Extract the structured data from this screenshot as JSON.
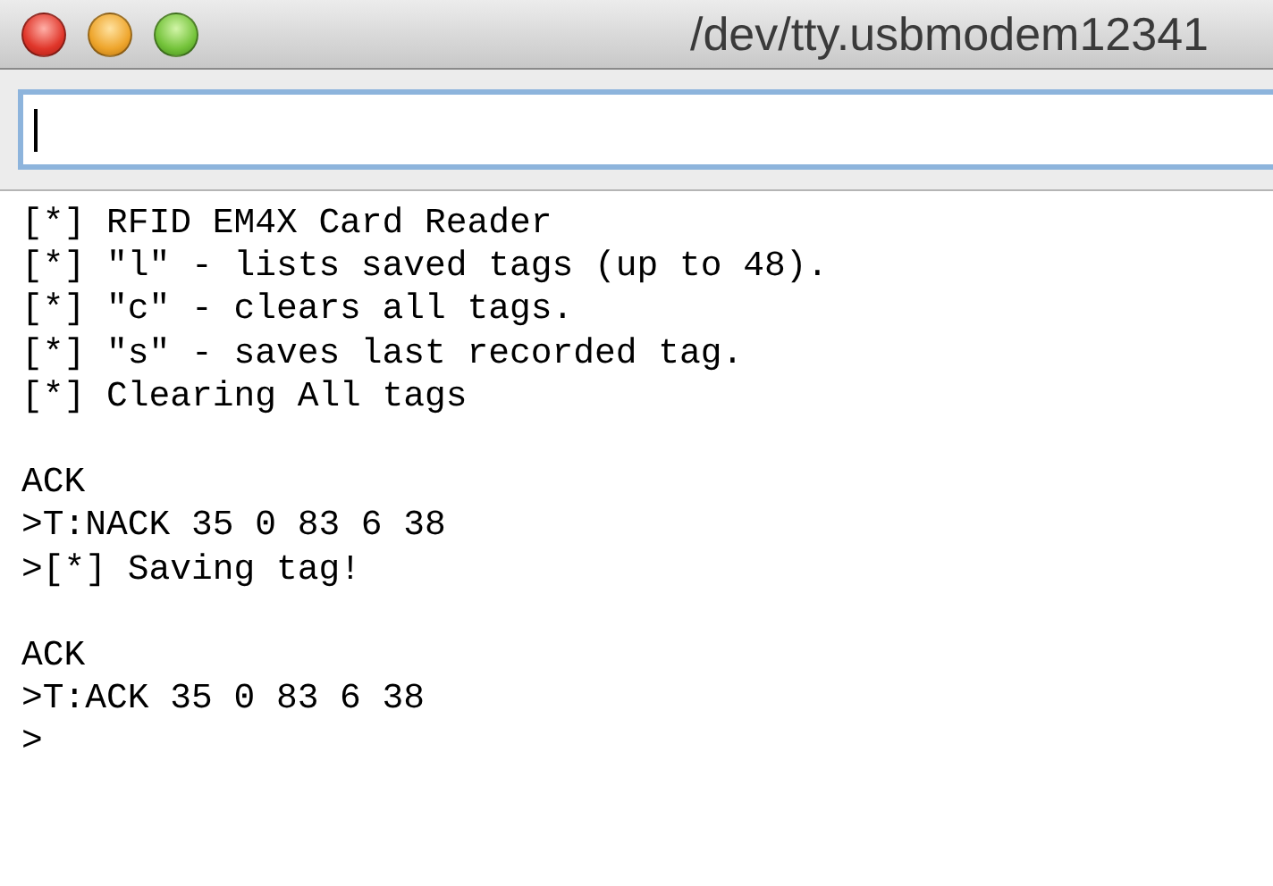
{
  "window": {
    "title": "/dev/tty.usbmodem12341"
  },
  "input": {
    "focused": true
  },
  "output": [
    [
      "[*] RFID EM4X Card Reader",
      "[*] \"l\" - lists saved tags (up to 48).",
      "[*] \"c\" - clears all tags.",
      "[*] \"s\" - saves last recorded tag.",
      "[*] Clearing All tags"
    ],
    [
      "ACK",
      ">T:NACK 35 0 83 6 38",
      ">[*] Saving tag!"
    ],
    [
      "ACK",
      ">T:ACK 35 0 83 6 38",
      ">"
    ]
  ]
}
